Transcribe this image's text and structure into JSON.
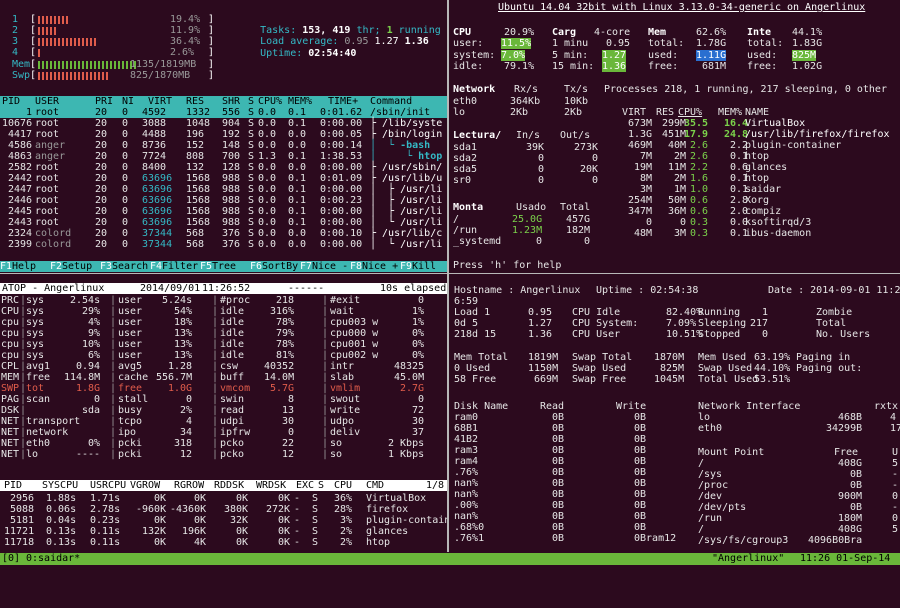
{
  "htop": {
    "meters": [
      {
        "num": "1",
        "percent": "19.4%",
        "fill": 0.194
      },
      {
        "num": "2",
        "percent": "11.9%",
        "fill": 0.119
      },
      {
        "num": "3",
        "percent": "36.4%",
        "fill": 0.364
      },
      {
        "num": "4",
        "percent": "2.6%",
        "fill": 0.026
      }
    ],
    "mem_label": "Mem",
    "mem_value": "1135/1819MB",
    "swp_label": "Swp",
    "swp_value": "825/1870MB",
    "tasks_label": "Tasks:",
    "tasks_count": "153,",
    "threads": "419",
    "thr_label": "thr;",
    "running_count": "1",
    "running_label": "running",
    "load_label": "Load average:",
    "load1": "0.95",
    "load5": "1.27",
    "load15": "1.36",
    "uptime_label": "Uptime:",
    "uptime": "02:54:40",
    "header_cols": [
      "PID",
      "USER",
      "PRI",
      "NI",
      "VIRT",
      "RES",
      "SHR",
      "S",
      "CPU%",
      "MEM%",
      "TIME+",
      "Command"
    ],
    "rows": [
      [
        "1",
        "root",
        "20",
        "0",
        "4592",
        "1332",
        "556",
        "S",
        "0.0",
        "0.1",
        "0:01.62",
        "/sbin/init"
      ],
      [
        "10676",
        "root",
        "20",
        "0",
        "3088",
        "1048",
        "904",
        "S",
        "0.0",
        "0.1",
        "0:00.00",
        "├ /lib/syste"
      ],
      [
        "4417",
        "root",
        "20",
        "0",
        "4488",
        "196",
        "192",
        "S",
        "0.0",
        "0.0",
        "0:00.05",
        "├ /bin/login"
      ],
      [
        "4586",
        "anger",
        "20",
        "0",
        "8736",
        "152",
        "148",
        "S",
        "0.0",
        "0.0",
        "0:00.14",
        "│  └ -bash"
      ],
      [
        "4863",
        "anger",
        "20",
        "0",
        "7724",
        "808",
        "700",
        "S",
        "1.3",
        "0.1",
        "1:38.53",
        "│     └ htop"
      ],
      [
        "2582",
        "root",
        "20",
        "0",
        "8400",
        "132",
        "128",
        "S",
        "0.0",
        "0.0",
        "0:00.00",
        "├ /usr/sbin/"
      ],
      [
        "2442",
        "root",
        "20",
        "0",
        "63696",
        "1568",
        "988",
        "S",
        "0.0",
        "0.1",
        "0:01.09",
        "├ /usr/lib/u"
      ],
      [
        "2447",
        "root",
        "20",
        "0",
        "63696",
        "1568",
        "988",
        "S",
        "0.0",
        "0.1",
        "0:00.00",
        "│  ├ /usr/li"
      ],
      [
        "2446",
        "root",
        "20",
        "0",
        "63696",
        "1568",
        "988",
        "S",
        "0.0",
        "0.1",
        "0:00.23",
        "│  ├ /usr/li"
      ],
      [
        "2445",
        "root",
        "20",
        "0",
        "63696",
        "1568",
        "988",
        "S",
        "0.0",
        "0.1",
        "0:00.00",
        "│  ├ /usr/li"
      ],
      [
        "2443",
        "root",
        "20",
        "0",
        "63696",
        "1568",
        "988",
        "S",
        "0.0",
        "0.1",
        "0:00.00",
        "│  └ /usr/li"
      ],
      [
        "2324",
        "colord",
        "20",
        "0",
        "37344",
        "568",
        "376",
        "S",
        "0.0",
        "0.0",
        "0:00.10",
        "├ /usr/lib/c"
      ],
      [
        "2399",
        "colord",
        "20",
        "0",
        "37344",
        "568",
        "376",
        "S",
        "0.0",
        "0.0",
        "0:00.00",
        "│  └ /usr/li"
      ]
    ],
    "fkeys": [
      {
        "key": "F1",
        "label": "Help"
      },
      {
        "key": "F2",
        "label": "Setup"
      },
      {
        "key": "F3",
        "label": "Search"
      },
      {
        "key": "F4",
        "label": "Filter"
      },
      {
        "key": "F5",
        "label": "Tree"
      },
      {
        "key": "F6",
        "label": "SortBy"
      },
      {
        "key": "F7",
        "label": "Nice -"
      },
      {
        "key": "F8",
        "label": "Nice +"
      },
      {
        "key": "F9",
        "label": "Kill"
      },
      {
        "key": "F10",
        "label": ""
      }
    ]
  },
  "glances": {
    "title": "Ubuntu 14.04 32bit with Linux 3.13.0-34-generic on Angerlinux",
    "cpu": {
      "label": "CPU",
      "total": "20.9%",
      "user_label": "user:",
      "user": "11.5%",
      "system_label": "system:",
      "system": "7.0%",
      "idle_label": "idle:",
      "idle": "79.1%"
    },
    "load": {
      "label": "Carg",
      "cores": "4-core",
      "l1_label": "1 minu",
      "l1": "0.95",
      "l5_label": "5 min:",
      "l5": "1.27",
      "l15_label": "15 min:",
      "l15": "1.36"
    },
    "mem": {
      "label": "Mem",
      "pct": "62.6%",
      "total_label": "total:",
      "total": "1.78G",
      "used_label": "used:",
      "used": "1.11G",
      "free_label": "free:",
      "free": "681M"
    },
    "swap": {
      "label": "Inte",
      "pct": "44.1%",
      "total_label": "total:",
      "total": "1.83G",
      "used_label": "used:",
      "used": "825M",
      "free_label": "free:",
      "free": "1.02G"
    },
    "net_header": [
      "Network",
      "Rx/s",
      "Tx/s"
    ],
    "net_rows": [
      [
        "eth0",
        "364Kb",
        "10Kb"
      ],
      [
        "lo",
        "2Kb",
        "2Kb"
      ]
    ],
    "proc_summary": "Processes 218, 1 running, 217 sleeping, 0 other",
    "proc_header": [
      "VIRT",
      "RES",
      "CPU%",
      "MEM%",
      "NAME"
    ],
    "proc_rows": [
      [
        "673M",
        "299M",
        "35.5",
        "16.4",
        "VirtualBox"
      ],
      [
        "1.3G",
        "451M",
        "17.9",
        "24.8",
        "/usr/lib/firefox/firefox"
      ],
      [
        "469M",
        "40M",
        "2.6",
        "2.2",
        "plugin-container"
      ],
      [
        "7M",
        "2M",
        "2.6",
        "0.1",
        "htop"
      ],
      [
        "19M",
        "11M",
        "2.2",
        "0.6",
        "glances"
      ],
      [
        "8M",
        "2M",
        "1.6",
        "0.1",
        "htop"
      ],
      [
        "3M",
        "1M",
        "1.0",
        "0.1",
        "saidar"
      ],
      [
        "254M",
        "50M",
        "0.6",
        "2.8",
        "Xorg"
      ],
      [
        "347M",
        "36M",
        "0.6",
        "2.0",
        "compiz"
      ],
      [
        "0",
        "0",
        "0.3",
        "0.0",
        "ksoftirqd/3"
      ],
      [
        "48M",
        "3M",
        "0.3",
        "0.1",
        "ibus-daemon"
      ]
    ],
    "disk_header": [
      "Lectura/",
      "In/s",
      "Out/s"
    ],
    "disk_rows": [
      [
        "sda1",
        "39K",
        "273K"
      ],
      [
        "sda2",
        "0",
        "0"
      ],
      [
        "sda5",
        "0",
        "20K"
      ],
      [
        "sr0",
        "0",
        "0"
      ]
    ],
    "fs_header": [
      "Monta",
      "Usado",
      "Total"
    ],
    "fs_rows": [
      [
        "/",
        "25.0G",
        "457G"
      ],
      [
        "/run",
        "1.23M",
        "182M"
      ],
      [
        "_systemd",
        "0",
        "0"
      ]
    ],
    "help": "Press 'h' for help"
  },
  "atop": {
    "title_left": "ATOP - Angerlinux",
    "date": "2014/09/01",
    "time": "11:26:52",
    "elapsed": "10s elapsed",
    "rows": [
      [
        "PRC",
        "sys",
        "2.54s",
        "user",
        "5.24s",
        "#proc",
        "218",
        "#exit",
        "0"
      ],
      [
        "CPU",
        "sys",
        "29%",
        "user",
        "54%",
        "idle",
        "316%",
        "wait",
        "1%"
      ],
      [
        "cpu",
        "sys",
        "4%",
        "user",
        "18%",
        "idle",
        "78%",
        "cpu003 w",
        "1%"
      ],
      [
        "cpu",
        "sys",
        "9%",
        "user",
        "13%",
        "idle",
        "79%",
        "cpu000 w",
        "0%"
      ],
      [
        "cpu",
        "sys",
        "10%",
        "user",
        "13%",
        "idle",
        "78%",
        "cpu001 w",
        "0%"
      ],
      [
        "cpu",
        "sys",
        "6%",
        "user",
        "13%",
        "idle",
        "81%",
        "cpu002 w",
        "0%"
      ],
      [
        "CPL",
        "avg1",
        "0.94",
        "avg5",
        "1.28",
        "csw",
        "40352",
        "intr",
        "48325"
      ],
      [
        "MEM",
        "free",
        "114.8M",
        "cache",
        "556.7M",
        "buff",
        "14.0M",
        "slab",
        "45.0M"
      ],
      [
        "SWP",
        "tot",
        "1.8G",
        "free",
        "1.0G",
        "vmcom",
        "5.7G",
        "vmlim",
        "2.7G"
      ],
      [
        "PAG",
        "scan",
        "0",
        "stall",
        "0",
        "swin",
        "8",
        "swout",
        "0"
      ],
      [
        "DSK",
        "",
        "sda",
        "busy",
        "2%",
        "read",
        "13",
        "write",
        "72"
      ],
      [
        "NET",
        "transport",
        "",
        "tcpo",
        "4",
        "udpi",
        "30",
        "udpo",
        "30"
      ],
      [
        "NET",
        "network",
        "",
        "ipo",
        "34",
        "ipfrw",
        "0",
        "deliv",
        "37"
      ],
      [
        "NET",
        "eth0",
        "0%",
        "pcki",
        "318",
        "pcko",
        "22",
        "so",
        "2 Kbps"
      ],
      [
        "NET",
        "lo",
        "----",
        "pcki",
        "12",
        "pcko",
        "12",
        "so",
        "1 Kbps"
      ]
    ],
    "proc_header": [
      "PID",
      "SYSCPU",
      "USRCPU",
      "VGROW",
      "RGROW",
      "RDDSK",
      "WRDSK",
      "EXC",
      "S",
      "CPU",
      "CMD",
      "1/8"
    ],
    "proc_rows": [
      [
        "2956",
        "1.88s",
        "1.71s",
        "0K",
        "0K",
        "0K",
        "0K",
        "-",
        "S",
        "36%",
        "VirtualBox"
      ],
      [
        "5088",
        "0.06s",
        "2.78s",
        "-960K",
        "-4360K",
        "380K",
        "272K",
        "-",
        "S",
        "28%",
        "firefox"
      ],
      [
        "5181",
        "0.04s",
        "0.23s",
        "0K",
        "0K",
        "32K",
        "0K",
        "-",
        "S",
        "3%",
        "plugin-contain"
      ],
      [
        "11721",
        "0.13s",
        "0.11s",
        "132K",
        "196K",
        "0K",
        "0K",
        "-",
        "S",
        "2%",
        "glances"
      ],
      [
        "11718",
        "0.13s",
        "0.11s",
        "0K",
        "4K",
        "0K",
        "0K",
        "-",
        "S",
        "2%",
        "htop"
      ]
    ]
  },
  "saidar": {
    "hostname_label": "Hostname",
    "hostname": "Angerlinux",
    "uptime_label": "Uptime",
    "uptime": "02:54:38",
    "date_label": "Date",
    "date": "2014-09-01 11:2",
    "date_cont": "6:59",
    "load_rows": [
      [
        "Load 1",
        "0.95",
        "CPU Idle",
        "82.40%",
        "Running",
        "1",
        "Zombie",
        ""
      ],
      [
        "0d 5",
        "1.27",
        "CPU System:",
        "7.09%",
        "Sleeping",
        "217",
        "Total",
        ""
      ],
      [
        "218d 15",
        "1.36",
        "CPU User",
        "10.51%",
        "Stopped",
        "0",
        "No. Users",
        ""
      ]
    ],
    "mem_rows": [
      [
        "Mem Total",
        "1819M",
        "Swap Total",
        "1870M",
        "Mem Used",
        "63.19%",
        "Paging in",
        ""
      ],
      [
        "0 Used",
        "1150M",
        "Swap Used",
        "825M",
        "Swap Used",
        "44.10%",
        "Paging out:",
        ""
      ],
      [
        "58 Free",
        "669M",
        "Swap Free",
        "1045M",
        "Total Used",
        "53.51%",
        "",
        ""
      ]
    ],
    "disk_header": [
      "Disk Name",
      "Read",
      "Write"
    ],
    "disk_rows": [
      [
        "ram0",
        "0B",
        "0B"
      ],
      [
        "68B1",
        "0B",
        "0B"
      ],
      [
        "41B2",
        "0B",
        "0B"
      ],
      [
        "ram3",
        "0B",
        "0B"
      ],
      [
        "ram4",
        "0B",
        "0B"
      ],
      [
        ".76%",
        "0B",
        "0B"
      ],
      [
        "nan%",
        "0B",
        "0B"
      ],
      [
        "nan%",
        "0B",
        "0B"
      ],
      [
        ".00%",
        "0B",
        "0B"
      ],
      [
        "nan%",
        "0B",
        "0B"
      ],
      [
        ".68%0",
        "0B",
        "0B"
      ],
      [
        ".76%1",
        "0B",
        "0Bram12"
      ]
    ],
    "net_header": [
      "Network Interface",
      "rxtx"
    ],
    "net_rows": [
      [
        "lo",
        "468B",
        "4"
      ],
      [
        "eth0",
        "34299B",
        "17"
      ]
    ],
    "mount_header": [
      "Mount Point",
      "Free",
      "U"
    ],
    "mount_rows": [
      [
        "/",
        "408G",
        "5"
      ],
      [
        "/sys",
        "0B",
        "-"
      ],
      [
        "/proc",
        "0B",
        "-"
      ],
      [
        "/dev",
        "900M",
        "0"
      ],
      [
        "/dev/pts",
        "0B",
        "-"
      ],
      [
        "/run",
        "180M",
        "0"
      ],
      [
        "/",
        "408G",
        "5"
      ],
      [
        "/sys/fs/cgroup3",
        "4096B0Bra",
        ""
      ]
    ]
  },
  "tmux": {
    "index": "[0]",
    "window": "0:saidar*",
    "host": "\"Angerlinux\"",
    "clock": "11:26 01-Sep-14"
  }
}
